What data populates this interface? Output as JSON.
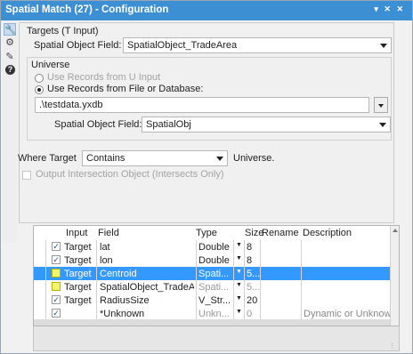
{
  "window": {
    "title": "Spatial Match (27) - Configuration",
    "controls": "▾ ✕ ✕"
  },
  "toolstrip": {
    "items": [
      "wrench-icon",
      "gear-icon",
      "tag-icon",
      "help-icon"
    ]
  },
  "targets": {
    "heading": "Targets (T Input)",
    "field_label": "Spatial Object Field:",
    "field_value": "SpatialObject_TradeArea"
  },
  "universe": {
    "heading": "Universe",
    "option_u_input": "Use Records from U Input",
    "option_file_db": "Use Records from File or Database:",
    "file_path": ".\\testdata.yxdb",
    "field_label": "Spatial Object Field:",
    "field_value": "SpatialObj"
  },
  "where": {
    "label": "Where Target",
    "value": "Contains",
    "suffix": "Universe."
  },
  "output_intersection": {
    "label": "Output Intersection Object (Intersects Only)",
    "checked": false
  },
  "grid": {
    "headers": {
      "input": "Input",
      "field": "Field",
      "type": "Type",
      "size": "Size",
      "rename": "Rename",
      "description": "Description"
    },
    "rows": [
      {
        "checked": true,
        "input": "Target",
        "field": "lat",
        "type": "Double",
        "size": "8",
        "rename": "",
        "description": "",
        "selected": false,
        "highlight": false
      },
      {
        "checked": true,
        "input": "Target",
        "field": "lon",
        "type": "Double",
        "size": "8",
        "rename": "",
        "description": "",
        "selected": false,
        "highlight": false
      },
      {
        "checked": false,
        "input": "Target",
        "field": "Centroid",
        "type": "Spati...",
        "size": "5...",
        "rename": "",
        "description": "",
        "selected": true,
        "highlight": true
      },
      {
        "checked": false,
        "input": "Target",
        "field": "SpatialObject_TradeArea",
        "type": "Spati...",
        "size": "5...",
        "rename": "",
        "description": "",
        "selected": false,
        "highlight": true
      },
      {
        "checked": true,
        "input": "Target",
        "field": "RadiusSize",
        "type": "V_Str...",
        "size": "20",
        "rename": "",
        "description": "",
        "selected": false,
        "highlight": false
      },
      {
        "checked": true,
        "input": "",
        "field": "*Unknown",
        "type": "Unkn...",
        "size": "0",
        "rename": "",
        "description": "Dynamic or Unknown Fiel",
        "selected": false,
        "highlight": false
      }
    ]
  }
}
